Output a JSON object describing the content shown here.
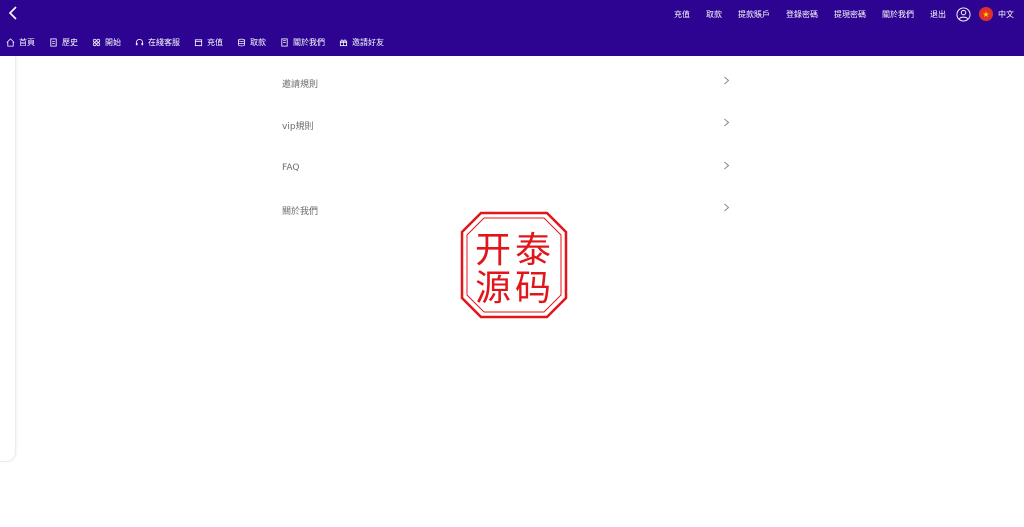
{
  "topbar": {
    "links": [
      "充值",
      "取款",
      "提款賬戶",
      "登錄密碼",
      "提現密碼",
      "關於我們",
      "退出"
    ],
    "language": "中文",
    "bg_color": "#2d0492"
  },
  "navbar": {
    "items": [
      {
        "label": "首頁",
        "icon": "home-icon"
      },
      {
        "label": "歷史",
        "icon": "document-icon"
      },
      {
        "label": "開始",
        "icon": "grid-icon"
      },
      {
        "label": "在綫客服",
        "icon": "headset-icon"
      },
      {
        "label": "充值",
        "icon": "wallet-icon"
      },
      {
        "label": "取款",
        "icon": "database-icon"
      },
      {
        "label": "關於我們",
        "icon": "book-icon"
      },
      {
        "label": "邀請好友",
        "icon": "gift-icon"
      }
    ]
  },
  "menu": {
    "items": [
      "邀請規則",
      "vip規則",
      "FAQ",
      "關於我們"
    ]
  },
  "watermark": {
    "text": "开泰源码",
    "color": "#e0161a"
  }
}
